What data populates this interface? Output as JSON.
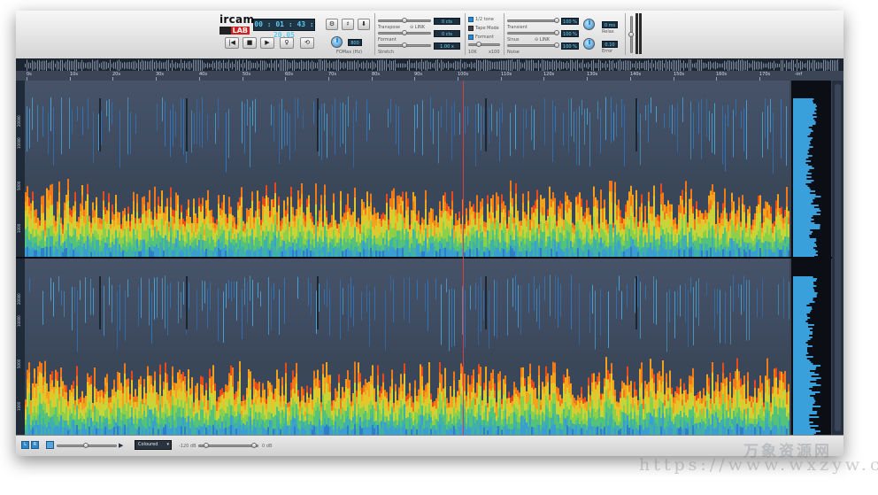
{
  "brand": {
    "logo_top": "ircam",
    "logo_bottom": "LAB"
  },
  "transport": {
    "time": "00 : 01 : 43 : 20.05",
    "buttons": [
      "rewind",
      "stop",
      "play",
      "record",
      "loop"
    ],
    "icons": {
      "rewind": "|◀",
      "stop": "■",
      "play": "▶",
      "record": "♀",
      "loop": "⟲"
    }
  },
  "settings_buttons": {
    "gear": "⚙",
    "sharp": "♯",
    "pin": "⬇"
  },
  "fomax": {
    "value": "800",
    "label": "FOMax (Hz)"
  },
  "pitch_panel": {
    "transpose_label": "Transpose",
    "transpose_value": "0 cts",
    "link_label": "⊝ LINK",
    "formant_label": "Formant",
    "formant_value": "0 cts",
    "stretch_label": "Stretch",
    "stretch_value": "1.00 x"
  },
  "modes": {
    "half_tone": "1/2 tone",
    "tape_mode": "Tape Mode",
    "formant": "Formant",
    "range_min": "10K",
    "range_max": "x100"
  },
  "mix_panel": {
    "transient_label": "Transient",
    "transient_value": "100 %",
    "sinus_label": "Sinus",
    "sinus_link": "⊝ LINK",
    "sinus_value": "100 %",
    "noise_label": "Noise",
    "noise_value": "100 %",
    "relax_value": "0 ms",
    "relax_label": "Relax",
    "error_value": "0.10",
    "error_label": "Error"
  },
  "ruler": {
    "ticks": [
      "0s",
      "10s",
      "20s",
      "30s",
      "40s",
      "50s",
      "60s",
      "70s",
      "80s",
      "90s",
      "100s",
      "110s",
      "120s",
      "130s",
      "140s",
      "150s",
      "160s",
      "170s"
    ],
    "end_label": "-inf"
  },
  "freq_axis": [
    "20000",
    "10000",
    "5000",
    "1000"
  ],
  "bottom": {
    "btn_l": "L",
    "btn_r": "R",
    "color_mode": "Coloured",
    "db_min": "-120 dB",
    "db_max": "0 dB"
  },
  "watermark": {
    "line1": "万象资源网",
    "line2": "https://www.wxzyw.cn"
  },
  "colors": {
    "accent": "#2f86c8",
    "readout_text": "#5ec8f0",
    "spectrogram_bg": "#3a4556",
    "playhead": "#d0404a"
  }
}
